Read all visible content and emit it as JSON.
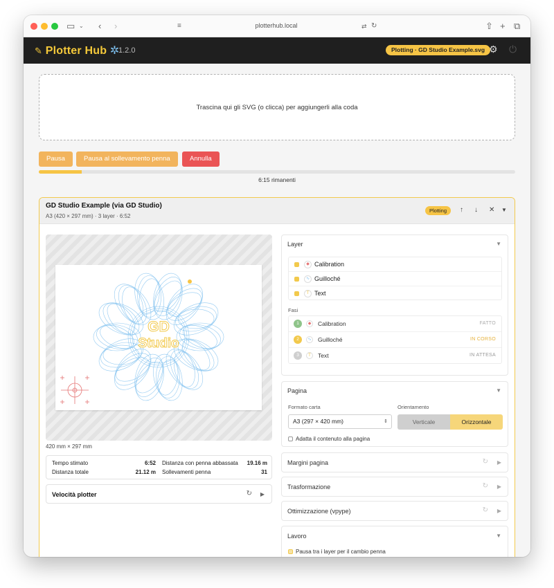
{
  "browser": {
    "url": "plotterhub.local"
  },
  "header": {
    "brand_main": "Plotter Hub",
    "version": "1.2.0",
    "status": "Plotting · GD Studio Example.svg"
  },
  "dropzone": {
    "text": "Trascina qui gli SVG (o clicca) per aggiungerli alla coda"
  },
  "controls": {
    "pause": "Pausa",
    "pause_pen_lift": "Pausa al sollevamento penna",
    "cancel": "Annulla",
    "progress_fraction": 0.09,
    "remaining": "6:15 rimanenti"
  },
  "job": {
    "title": "GD Studio Example (via GD Studio)",
    "meta": "A3 (420 × 297 mm) · 3 layer · 6:52",
    "badge": "Plotting",
    "preview_text_line1": "GD",
    "preview_text_line2": "Studio",
    "dimensions": "420 mm × 297 mm",
    "stats": {
      "est_time_label": "Tempo stimato",
      "est_time": "6:52",
      "pen_down_label": "Distanza con penna abbassata",
      "pen_down": "19.16 m",
      "total_label": "Distanza totale",
      "total": "21.12 m",
      "lifts_label": "Sollevamenti penna",
      "lifts": "31"
    },
    "speed_label": "Velocità plotter"
  },
  "layers_panel": {
    "title": "Layer",
    "layers": [
      {
        "name": "Calibration",
        "color": "#e57373"
      },
      {
        "name": "Guilloché",
        "color": "#7ec0ef"
      },
      {
        "name": "Text",
        "color": "#f2c94c"
      }
    ],
    "phases_label": "Fasi",
    "phases": [
      {
        "num": "1",
        "name": "Calibration",
        "state": "FATTO",
        "num_color": "#8fc48a",
        "state_color": "#aaaaaa"
      },
      {
        "num": "2",
        "name": "Guilloché",
        "state": "IN CORSO",
        "num_color": "#f2c94c",
        "state_color": "#e6b13b"
      },
      {
        "num": "3",
        "name": "Text",
        "state": "IN ATTESA",
        "num_color": "#cfcfcf",
        "state_color": "#999999"
      }
    ]
  },
  "page_panel": {
    "title": "Pagina",
    "paper_label": "Formato carta",
    "paper_value": "A3 (297 × 420 mm)",
    "orientation_label": "Orientamento",
    "portrait": "Verticale",
    "landscape": "Orizzontale",
    "fit_label": "Adatta il contenuto alla pagina"
  },
  "sections": {
    "margins": "Margini pagina",
    "transform": "Trasformazione",
    "optimize": "Ottimizzazione (vpype)",
    "job": "Lavoro",
    "job_option1": "Pausa tra i layer per il cambio penna"
  },
  "colors": {
    "accent": "#f6c445",
    "danger": "#ea5455",
    "guilloche": "#7ec0ef",
    "calibration": "#e57373"
  }
}
